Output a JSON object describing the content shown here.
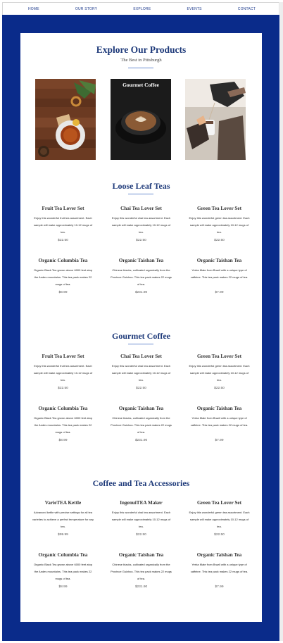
{
  "nav": [
    "HOME",
    "OUR STORY",
    "EXPLORE",
    "EVENTS",
    "CONTACT"
  ],
  "hero": {
    "title": "Explore Our Products",
    "subtitle": "The Best in Pittsburgh",
    "photos": [
      {
        "caption": ""
      },
      {
        "caption": "Gourmet Coffee"
      },
      {
        "caption": ""
      }
    ]
  },
  "sections": [
    {
      "title": "Loose Leaf Teas",
      "items": [
        {
          "title": "Fruit Tea Lover Set",
          "desc": "Enjoy this wonderful fruit tea assortment. Each sample will make approximately 10-12 mugs of tea.",
          "price": "$22.50"
        },
        {
          "title": "Chai Tea Lover Set",
          "desc": "Enjoy this wonderful chai tea assortment. Each sample will make approximately 10-12 mugs of tea.",
          "price": "$22.50"
        },
        {
          "title": "Green Tea Lover Set",
          "desc": "Enjoy this wonderful green tea assortment. Each sample will make approximately 10-12 mugs of tea.",
          "price": "$22.50"
        },
        {
          "title": "Organic Columbia Tea",
          "desc": "Organic Black Tea grown above 6000 feet atop the Andes mountains. This tea pack makes 22 mugs of tea.",
          "price": "$8.99"
        },
        {
          "title": "Organic Taishan Tea",
          "desc": "Chinese blacks, cultivated organically from the Province Guizhou. This tea pack makes 22 mugs of tea.",
          "price": "$231.90"
        },
        {
          "title": "Organic Taishan Tea",
          "desc": "Yerba Mate from Brazil with a unique type of caffeine. This tea pack makes 22 mugs of tea.",
          "price": "$7.99"
        }
      ]
    },
    {
      "title": "Gourmet Coffee",
      "items": [
        {
          "title": "Fruit Tea Lover Set",
          "desc": "Enjoy this wonderful fruit tea assortment. Each sample will make approximately 10-12 mugs of tea.",
          "price": "$22.50"
        },
        {
          "title": "Chai Tea Lover Set",
          "desc": "Enjoy this wonderful chai tea assortment. Each sample will make approximately 10-12 mugs of tea.",
          "price": "$22.50"
        },
        {
          "title": "Green Tea Lover Set",
          "desc": "Enjoy this wonderful green tea assortment. Each sample will make approximately 10-12 mugs of tea.",
          "price": "$22.50"
        },
        {
          "title": "Organic Columbia Tea",
          "desc": "Organic Black Tea grown above 6000 feet atop the Andes mountains. This tea pack makes 22 mugs of tea.",
          "price": "$8.99"
        },
        {
          "title": "Organic Taishan Tea",
          "desc": "Chinese blacks, cultivated organically from the Province Guizhou. This tea pack makes 22 mugs of tea.",
          "price": "$231.90"
        },
        {
          "title": "Organic Taishan Tea",
          "desc": "Yerba Mate from Brazil with a unique type of caffeine. This tea pack makes 22 mugs of tea.",
          "price": "$7.99"
        }
      ]
    },
    {
      "title": "Coffee and Tea Accessories",
      "items": [
        {
          "title": "VarieTEA Kettle",
          "desc": "Advanced kettle with precise settings for all tea varieties to achieve a perfect temperature for any tea.",
          "price": "$99.99"
        },
        {
          "title": "IngenuiTEA Maker",
          "desc": "Enjoy this wonderful chai tea assortment. Each sample will make approximately 10-12 mugs of tea.",
          "price": "$22.50"
        },
        {
          "title": "Green Tea Lover Set",
          "desc": "Enjoy this wonderful green tea assortment. Each sample will make approximately 10-12 mugs of tea.",
          "price": "$22.50"
        },
        {
          "title": "Organic Columbia Tea",
          "desc": "Organic Black Tea grown above 6000 feet atop the Andes mountains. This tea pack makes 22 mugs of tea.",
          "price": "$8.99"
        },
        {
          "title": "Organic Taishan Tea",
          "desc": "Chinese blacks, cultivated organically from the Province Guizhou. This tea pack makes 22 mugs of tea.",
          "price": "$231.90"
        },
        {
          "title": "Organic Taishan Tea",
          "desc": "Yerba Mate from Brazil with a unique type of caffeine. This tea pack makes 22 mugs of tea.",
          "price": "$7.99"
        }
      ]
    }
  ],
  "colors": {
    "frame": "#0a2b8a",
    "heading": "#1e3a7a",
    "nav": "#1c3a8c"
  }
}
